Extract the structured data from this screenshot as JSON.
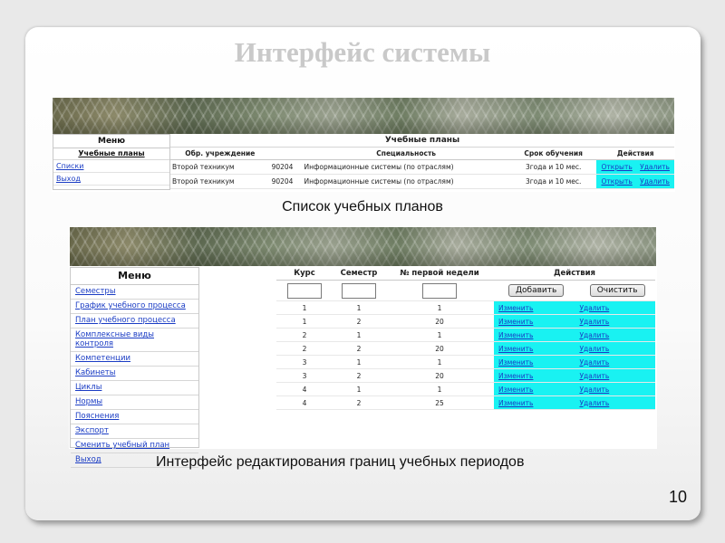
{
  "slide": {
    "title": "Интерфейс системы",
    "caption_top": "Список учебных планов",
    "caption_bottom": "Интерфейс редактирования границ учебных периодов",
    "page_number": "10"
  },
  "top_screen": {
    "menu_title": "Меню",
    "menu_section": "Учебные планы",
    "menu_links": [
      "Списки",
      "Выход"
    ],
    "table_group_title": "Учебные планы",
    "columns": [
      "Обр. учреждение",
      "Специальность",
      "Срок обучения",
      "Действия"
    ],
    "rows": [
      {
        "institution": "Второй техникум",
        "code": "90204",
        "specialty": "Информационные системы (по отраслям)",
        "duration": "3года и 10 мес.",
        "open": "Открыть",
        "delete": "Удалить"
      },
      {
        "institution": "Второй техникум",
        "code": "90204",
        "specialty": "Информационные системы (по отраслям)",
        "duration": "3года и 10 мес.",
        "open": "Открыть",
        "delete": "Удалить"
      }
    ]
  },
  "bottom_screen": {
    "menu_title": "Меню",
    "menu_links": [
      "Семестры",
      "График учебного процесса",
      "План учебного процесса",
      "Комплексные виды контроля",
      "Компетенции",
      "Кабинеты",
      "Циклы",
      "Нормы",
      "Пояснения",
      "Экспорт",
      "Сменить учебный план",
      "Выход"
    ],
    "columns": [
      "Курс",
      "Семестр",
      "№ первой недели",
      "Действия"
    ],
    "add_button": "Добавить",
    "clear_button": "Очистить",
    "rows": [
      {
        "course": "1",
        "semester": "1",
        "first_week": "1",
        "edit": "Изменить",
        "delete": "Удалить"
      },
      {
        "course": "1",
        "semester": "2",
        "first_week": "20",
        "edit": "Изменить",
        "delete": "Удалить"
      },
      {
        "course": "2",
        "semester": "1",
        "first_week": "1",
        "edit": "Изменить",
        "delete": "Удалить"
      },
      {
        "course": "2",
        "semester": "2",
        "first_week": "20",
        "edit": "Изменить",
        "delete": "Удалить"
      },
      {
        "course": "3",
        "semester": "1",
        "first_week": "1",
        "edit": "Изменить",
        "delete": "Удалить"
      },
      {
        "course": "3",
        "semester": "2",
        "first_week": "20",
        "edit": "Изменить",
        "delete": "Удалить"
      },
      {
        "course": "4",
        "semester": "1",
        "first_week": "1",
        "edit": "Изменить",
        "delete": "Удалить"
      },
      {
        "course": "4",
        "semester": "2",
        "first_week": "25",
        "edit": "Изменить",
        "delete": "Удалить"
      }
    ]
  },
  "colors": {
    "action_cell": "#19f2f2",
    "link": "#1a3cc4",
    "title": "#c9c9c9"
  }
}
